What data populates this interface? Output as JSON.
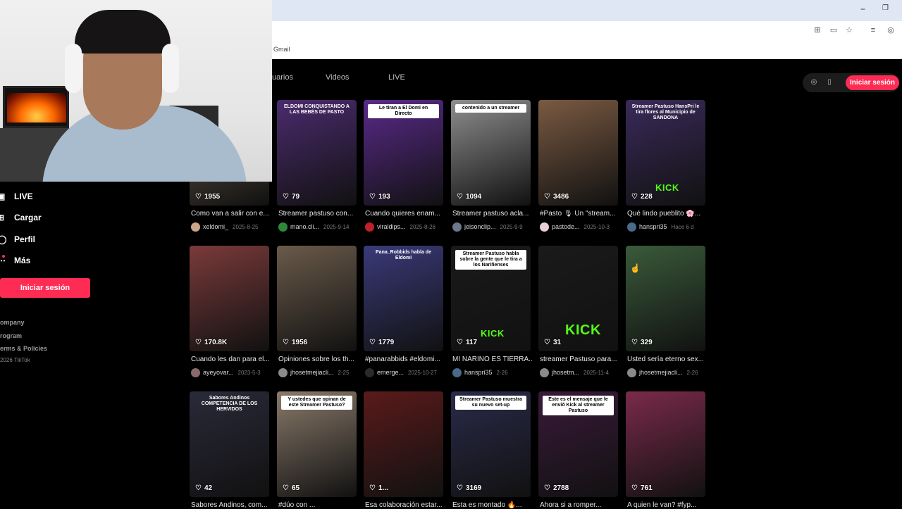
{
  "browser": {
    "bookmark": "Gmail",
    "minimize": "−",
    "restore": "❐"
  },
  "sidebar": {
    "items": [
      {
        "label": "LIVE",
        "icon": "live-icon"
      },
      {
        "label": "Cargar",
        "icon": "upload-icon"
      },
      {
        "label": "Perfil",
        "icon": "profile-icon"
      },
      {
        "label": "Más",
        "icon": "more-icon"
      }
    ],
    "login": "Iniciar sesión",
    "footer": [
      "ompany",
      "rogram",
      "erms & Policies"
    ],
    "copyright": "2026 TikTok"
  },
  "tabs": [
    "uarios",
    "Videos",
    "LIVE"
  ],
  "header": {
    "login": "Iniciar sesión"
  },
  "videos": [
    {
      "likes": "1955",
      "title": "Como van a salir con e...",
      "author": "xeldomi_",
      "date": "2025-8-25",
      "overlay": "",
      "thumb": "#6a5a4a",
      "avatar": "#c9a58a"
    },
    {
      "likes": "79",
      "title": "Streamer pastuso con...",
      "author": "mano.cli...",
      "date": "2025-9-14",
      "overlay": "ELDOMI CONQUISTANDO A LAS BEBÉS DE PASTO",
      "thumb": "#4b2b6e",
      "avatar": "#2d8a3a"
    },
    {
      "likes": "193",
      "title": "Cuando quieres enam...",
      "author": "viraldips...",
      "date": "2025-8-26",
      "overlay": "Le tiran a El Domi en Directo",
      "thumb": "#5a2a8a",
      "avatar": "#c0202a"
    },
    {
      "likes": "1094",
      "title": "Streamer pastuso acla...",
      "author": "jeisonclip...",
      "date": "2025-9-9",
      "overlay": "contenido a un streamer",
      "thumb": "#8e8e8e",
      "avatar": "#6a7a8a"
    },
    {
      "likes": "3486",
      "title": "#Pasto 🎙 Un \"stream...",
      "author": "pastode...",
      "date": "2025-10-3",
      "overlay": "",
      "thumb": "#7a5a42",
      "avatar": "#e8d0d8"
    },
    {
      "likes": "228",
      "title": "Qué lindo pueblito 🌸...",
      "author": "hanspri35",
      "date": "Hace 6 d",
      "overlay": "Streamer Pastuso HansPri le tira flores al Municipio de SANDONA",
      "thumb": "#3a2a5a",
      "avatar": "#4a6a8a"
    },
    {
      "likes": "170.8K",
      "title": "Cuando les dan para el...",
      "author": "ayeyovar...",
      "date": "2023-5-3",
      "overlay": "",
      "thumb": "#7a3a3a",
      "avatar": "#8a6a6a"
    },
    {
      "likes": "1956",
      "title": "Opiniones sobre los th...",
      "author": "jhosetmejiacli...",
      "date": "2-25",
      "overlay": "",
      "thumb": "#6a5a4a",
      "avatar": "#8a8a8a"
    },
    {
      "likes": "1779",
      "title": "#panarabbids #eldomi...",
      "author": "emerge...",
      "date": "2025-10-27",
      "overlay": "Pana_Robbids habla de Eldomi",
      "thumb": "#3a3a7a",
      "avatar": "#2a2a2a"
    },
    {
      "likes": "117",
      "title": "MI NARIÑO ES TIERRA...",
      "author": "hanspri35",
      "date": "2-26",
      "overlay": "Streamer Pastuso habla sobre la gente que le tira a los Nariñenses",
      "thumb": "#1a1a1a",
      "avatar": "#4a6a8a"
    },
    {
      "likes": "31",
      "title": "streamer Pastuso para...",
      "author": "jhosetm...",
      "date": "2025-11-4",
      "overlay": "",
      "thumb": "#1a1a1a",
      "avatar": "#8a8a8a"
    },
    {
      "likes": "329",
      "title": "Usted sería eterno sex...",
      "author": "jhosetmejiacli...",
      "date": "2-26",
      "overlay": "",
      "thumb": "#3a5a3a",
      "avatar": "#8a8a8a"
    },
    {
      "likes": "42",
      "title": "Sabores Andinos, com...",
      "author": "",
      "date": "",
      "overlay": "Sabores Andinos COMPETENCIA DE LOS HERVIDOS",
      "thumb": "#2a2a3a",
      "avatar": "#555"
    },
    {
      "likes": "65",
      "title": "#dúo con ...",
      "author": "",
      "date": "",
      "overlay": "Y ustedes que opinan de este Streamer Pastuso?",
      "thumb": "#8a7a6a",
      "avatar": "#555"
    },
    {
      "likes": "1...",
      "title": "Esa colaboración estar...",
      "author": "",
      "date": "",
      "overlay": "",
      "thumb": "#5a1a1a",
      "avatar": "#555"
    },
    {
      "likes": "3169",
      "title": "Esta es montado 🔥...",
      "author": "",
      "date": "",
      "overlay": "Streamer Pastuso muestra su nuevo set-up",
      "thumb": "#2a2a4a",
      "avatar": "#555"
    },
    {
      "likes": "2788",
      "title": "Ahora si a romper...",
      "author": "",
      "date": "",
      "overlay": "Este es el mensaje que le envió Kick al streamer Pastuso",
      "thumb": "#3a1a3a",
      "avatar": "#555"
    },
    {
      "likes": "761",
      "title": "A quien le van? #fyp...",
      "author": "",
      "date": "",
      "overlay": "",
      "thumb": "#7a2a4a",
      "avatar": "#555"
    }
  ],
  "kick_label": "KICK",
  "colors": {
    "accent": "#fe2c55",
    "kick": "#53fc18"
  }
}
